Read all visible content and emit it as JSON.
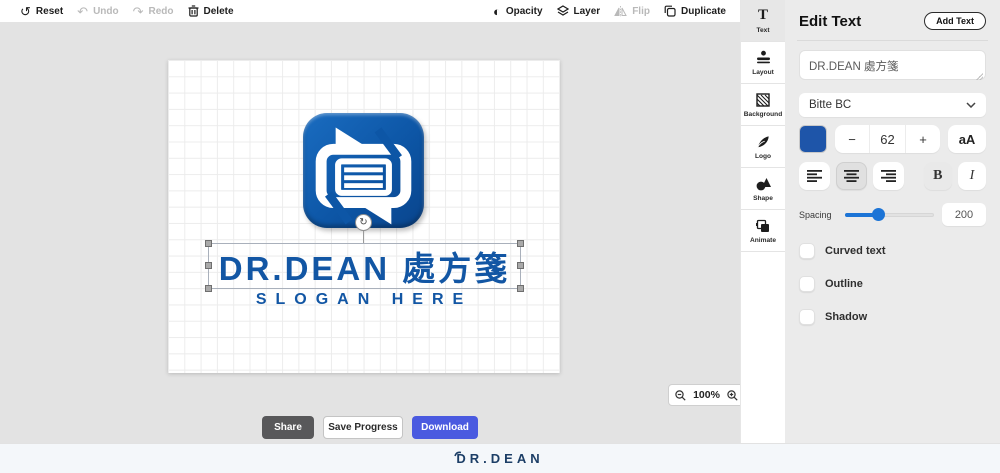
{
  "toolbar": {
    "left": [
      {
        "label": "Reset",
        "icon": "reset-icon",
        "disabled": false
      },
      {
        "label": "Undo",
        "icon": "undo-icon",
        "disabled": true
      },
      {
        "label": "Redo",
        "icon": "redo-icon",
        "disabled": true
      },
      {
        "label": "Delete",
        "icon": "trash-icon",
        "disabled": false
      }
    ],
    "right": [
      {
        "label": "Opacity",
        "icon": "opacity-icon",
        "disabled": false
      },
      {
        "label": "Layer",
        "icon": "layers-icon",
        "disabled": false
      },
      {
        "label": "Flip",
        "icon": "flip-icon",
        "disabled": true
      },
      {
        "label": "Duplicate",
        "icon": "duplicate-icon",
        "disabled": false
      }
    ]
  },
  "sidebar": {
    "items": [
      {
        "label": "Text",
        "active": true
      },
      {
        "label": "Layout",
        "active": false
      },
      {
        "label": "Background",
        "active": false
      },
      {
        "label": "Logo",
        "active": false
      },
      {
        "label": "Shape",
        "active": false
      },
      {
        "label": "Animate",
        "active": false
      }
    ]
  },
  "panel": {
    "title": "Edit Text",
    "add_text_label": "Add Text",
    "text_value": "DR.DEAN 處方箋",
    "font_name": "Bitte BC",
    "font_color": "#1e55a9",
    "decrease_label": "−",
    "font_size": "62",
    "increase_label": "+",
    "case_label": "aA",
    "bold_label": "B",
    "italic_label": "I",
    "spacing_label": "Spacing",
    "spacing_value": "200",
    "spacing_percent": 38,
    "options": [
      {
        "label": "Curved text",
        "checked": false
      },
      {
        "label": "Outline",
        "checked": false
      },
      {
        "label": "Shadow",
        "checked": false
      }
    ]
  },
  "canvas": {
    "zoom_value": "100%",
    "logo": {
      "title": "DR.DEAN 處方箋",
      "slogan": "SLOGAN HERE",
      "brand_blue": "#0d56a6",
      "text_blue": "#1256a4"
    }
  },
  "actions": {
    "share": "Share",
    "save": "Save Progress",
    "download": "Download"
  },
  "footer": {
    "brand": "DR.DEAN"
  },
  "colors": {
    "accent_blue": "#1c74d6",
    "download_blue": "#4a5ae0",
    "share_gray": "#58585a",
    "brand_navy": "#1c3e66",
    "panel_bg": "#ebebeb"
  }
}
